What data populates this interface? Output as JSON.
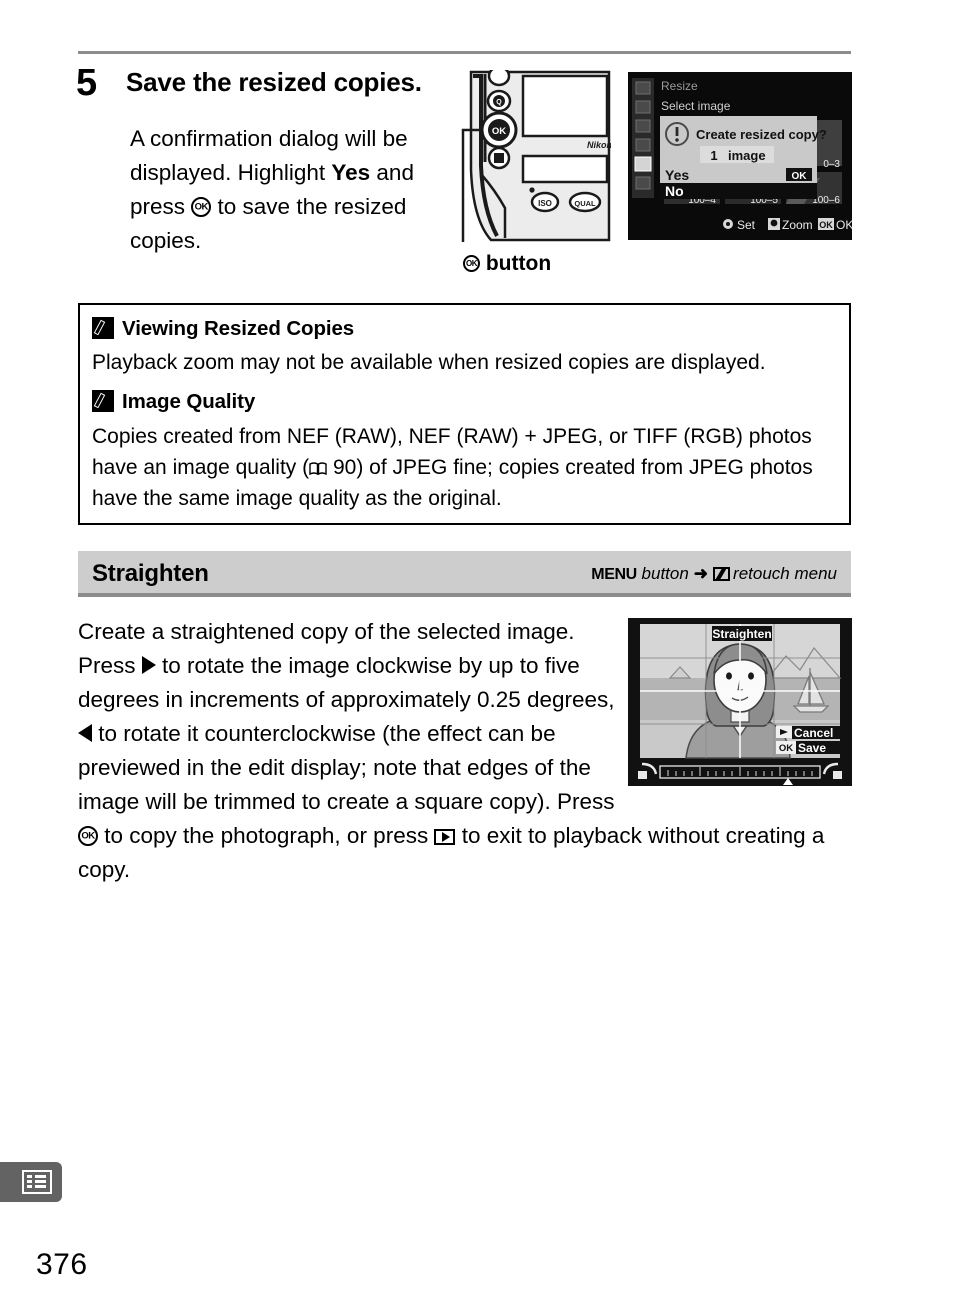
{
  "page": {
    "number": "376",
    "tab_icon": "menu-list-icon"
  },
  "step": {
    "number": "5",
    "title": "Save the resized copies.",
    "body_before_yes": "A confirmation dialog will be displayed.  Highlight ",
    "yes_bold": "Yes",
    "body_mid": " and press ",
    "ok_icon": "ok-button-icon",
    "body_after": " to save the resized copies."
  },
  "camera_figure": {
    "caption_icon": "ok-button-icon",
    "caption_text": "button",
    "brand": "Nikon",
    "buttons": [
      {
        "label": "⚑",
        "name": "protect-button"
      },
      {
        "label": "⊙",
        "name": "playback-zoom-out-button"
      },
      {
        "label": "OK",
        "name": "ok-button"
      },
      {
        "label": "⌸",
        "name": "info-button"
      },
      {
        "label": "ISO",
        "name": "iso-button"
      },
      {
        "label": "QUAL",
        "name": "qual-button"
      }
    ]
  },
  "lcd_resize": {
    "menu_title": "Resize",
    "submenu_title": "Select image",
    "dialog": {
      "icon": "warning-exclamation-icon",
      "question": "Create resized copy?",
      "count": "1",
      "count_unit": "image",
      "options": [
        {
          "label": "Yes",
          "badge": "OK",
          "selected": false
        },
        {
          "label": "No",
          "badge": "",
          "selected": true
        }
      ]
    },
    "thumbnails": [
      {
        "label": "100–4"
      },
      {
        "label": "100–5"
      },
      {
        "label": "100–6"
      }
    ],
    "status_bar": [
      {
        "icon": "set-icon",
        "label": "Set"
      },
      {
        "icon": "zoom-icon",
        "label": "Zoom"
      },
      {
        "icon": "ok-icon",
        "label": "OK"
      }
    ],
    "sidebar_icons": [
      "playback-menu-icon",
      "shooting-menu-icon",
      "custom-settings-menu-icon",
      "setup-menu-icon",
      "retouch-menu-icon",
      "recent-settings-menu-icon"
    ]
  },
  "notes": [
    {
      "icon": "pencil-note-icon",
      "heading": "Viewing Resized Copies",
      "text": "Playback zoom may not be available when resized copies are displayed."
    },
    {
      "icon": "pencil-note-icon",
      "heading": "Image Quality",
      "text_part1": "Copies created from NEF (RAW), NEF (RAW) + JPEG, or TIFF (RGB) photos have an image quality (",
      "page_ref": "90",
      "text_part2": ") of JPEG fine; copies created from JPEG photos have the same image quality as the original."
    }
  ],
  "section": {
    "title": "Straighten",
    "path_menu_word": "MENU",
    "path_button_word": "button",
    "path_arrow": "➜",
    "path_icon": "retouch-menu-icon",
    "path_target": "retouch menu"
  },
  "section_body": {
    "p1": "Create a straightened copy of the selected image.  Press ",
    "icon_right": "right-arrow-icon",
    "p2": " to rotate the image clockwise by up to five degrees in increments of approximately 0.25 degrees, ",
    "icon_left": "left-arrow-icon",
    "p3": " to rotate it counterclockwise (the effect can be previewed in the edit display; note that edges of the image will be trimmed to create a square copy).  Press ",
    "icon_ok": "ok-button-icon",
    "p4": " to copy the photograph, or press ",
    "icon_playback": "playback-button-icon",
    "p5": " to exit to playback without creating a copy."
  },
  "lcd_straighten": {
    "title": "Straighten",
    "cancel_badge": "▶",
    "cancel_label": "Cancel",
    "save_badge": "OK",
    "save_label": "Save",
    "slider": {
      "left_icon": "rotate-ccw-icon",
      "right_icon": "rotate-cw-icon",
      "marker_position_pct": 78
    },
    "scene": "portrait-with-sailboat-and-mountains"
  },
  "colors": {
    "rule": "#8c8c8c",
    "section_header_bg": "#cdcdcd",
    "section_header_border": "#8c8c8c",
    "tab_marker": "#636363",
    "lcd_background": "#000000",
    "lcd_dialog_bg": "#c9c9c9",
    "lcd_selected_bg": "#000000"
  }
}
